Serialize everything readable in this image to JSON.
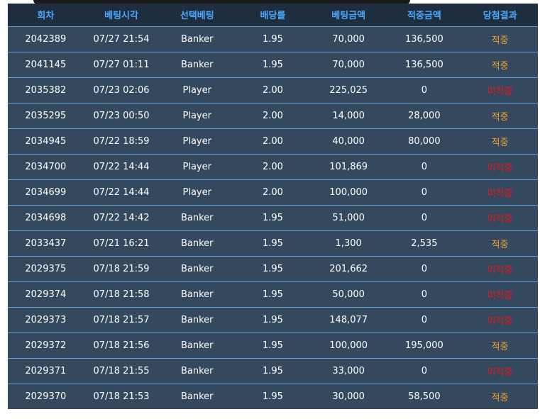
{
  "header": {
    "columns": [
      "회차",
      "베팅시각",
      "선택베팅",
      "배당률",
      "베팅금액",
      "적중금액",
      "당첨결과"
    ]
  },
  "rows": [
    {
      "round": "2042389",
      "time": "07/27 21:54",
      "pick": "Banker",
      "odds": "1.95",
      "bet": "70,000",
      "payout": "136,500",
      "result": "적중"
    },
    {
      "round": "2041145",
      "time": "07/27 01:11",
      "pick": "Banker",
      "odds": "1.95",
      "bet": "70,000",
      "payout": "136,500",
      "result": "적중"
    },
    {
      "round": "2035382",
      "time": "07/23 02:06",
      "pick": "Player",
      "odds": "2.00",
      "bet": "225,025",
      "payout": "0",
      "result": "미적중"
    },
    {
      "round": "2035295",
      "time": "07/23 00:50",
      "pick": "Player",
      "odds": "2.00",
      "bet": "14,000",
      "payout": "28,000",
      "result": "적중"
    },
    {
      "round": "2034945",
      "time": "07/22 18:59",
      "pick": "Player",
      "odds": "2.00",
      "bet": "40,000",
      "payout": "80,000",
      "result": "적중"
    },
    {
      "round": "2034700",
      "time": "07/22 14:44",
      "pick": "Player",
      "odds": "2.00",
      "bet": "101,869",
      "payout": "0",
      "result": "미적중"
    },
    {
      "round": "2034699",
      "time": "07/22 14:44",
      "pick": "Player",
      "odds": "2.00",
      "bet": "100,000",
      "payout": "0",
      "result": "미적중"
    },
    {
      "round": "2034698",
      "time": "07/22 14:42",
      "pick": "Banker",
      "odds": "1.95",
      "bet": "51,000",
      "payout": "0",
      "result": "미적중"
    },
    {
      "round": "2033437",
      "time": "07/21 16:21",
      "pick": "Banker",
      "odds": "1.95",
      "bet": "1,300",
      "payout": "2,535",
      "result": "적중"
    },
    {
      "round": "2029375",
      "time": "07/18 21:59",
      "pick": "Banker",
      "odds": "1.95",
      "bet": "201,662",
      "payout": "0",
      "result": "미적중"
    },
    {
      "round": "2029374",
      "time": "07/18 21:58",
      "pick": "Banker",
      "odds": "1.95",
      "bet": "50,000",
      "payout": "0",
      "result": "미적중"
    },
    {
      "round": "2029373",
      "time": "07/18 21:57",
      "pick": "Banker",
      "odds": "1.95",
      "bet": "148,077",
      "payout": "0",
      "result": "미적중"
    },
    {
      "round": "2029372",
      "time": "07/18 21:56",
      "pick": "Banker",
      "odds": "1.95",
      "bet": "100,000",
      "payout": "195,000",
      "result": "적중"
    },
    {
      "round": "2029371",
      "time": "07/18 21:55",
      "pick": "Banker",
      "odds": "1.95",
      "bet": "33,000",
      "payout": "0",
      "result": "미적중"
    },
    {
      "round": "2029370",
      "time": "07/18 21:53",
      "pick": "Banker",
      "odds": "1.95",
      "bet": "30,000",
      "payout": "58,500",
      "result": "적중"
    }
  ],
  "colors": {
    "header_text": "#4aa8ff",
    "row_bg": "#34495e",
    "row_border": "#5fa3d6",
    "win": "#f2a12e",
    "lose": "#e8161b"
  }
}
